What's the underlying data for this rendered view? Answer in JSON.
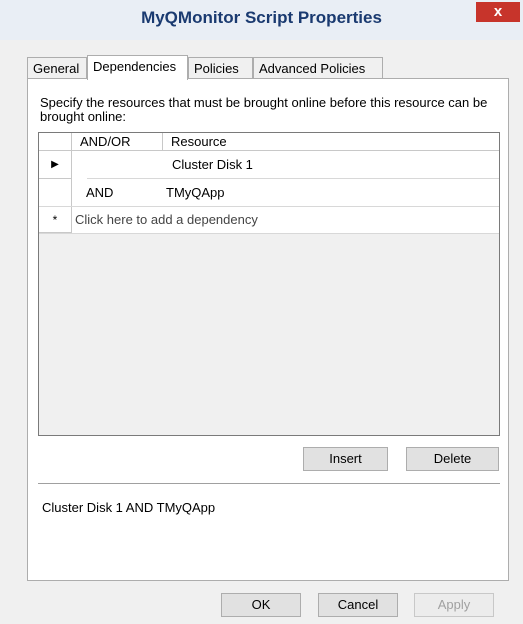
{
  "window": {
    "title": "MyQMonitor Script Properties",
    "close_label": "x"
  },
  "tabs": [
    {
      "label": "General"
    },
    {
      "label": "Dependencies"
    },
    {
      "label": "Policies"
    },
    {
      "label": "Advanced Policies"
    }
  ],
  "active_tab": "Dependencies",
  "instructions": "Specify the resources that must be brought online before this resource can be brought online:",
  "grid": {
    "columns": [
      "AND/OR",
      "Resource"
    ],
    "rows": [
      {
        "marker": "▶",
        "andor": "",
        "resource": "Cluster Disk 1"
      },
      {
        "marker": "",
        "andor": "AND",
        "resource": "TMyQApp"
      }
    ],
    "new_row_marker": "*",
    "new_row_placeholder": "Click here to add a dependency"
  },
  "buttons": {
    "insert": "Insert",
    "delete": "Delete",
    "ok": "OK",
    "cancel": "Cancel",
    "apply": "Apply"
  },
  "summary": "Cluster Disk 1 AND TMyQApp",
  "colors": {
    "title_text": "#1a3a70",
    "close_button": "#c7342b",
    "dialog_bg": "#f0f0f0",
    "disabled_text": "#a0a0a0"
  }
}
